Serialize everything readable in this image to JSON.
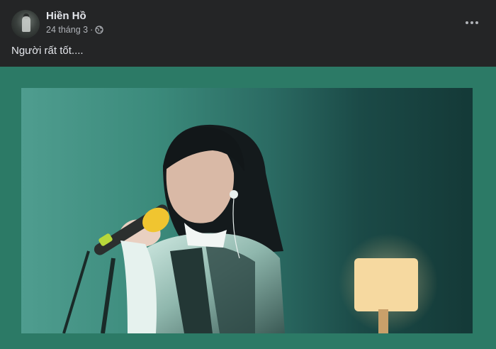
{
  "post": {
    "author_name": "Hiền Hồ",
    "date": "24 tháng 3",
    "separator": "·",
    "privacy_icon": "globe-icon",
    "more_icon": "more-horizontal-icon",
    "text": "Người rất tốt....",
    "frame_color": "#2c7a66",
    "photo_description_icon": "photo"
  }
}
